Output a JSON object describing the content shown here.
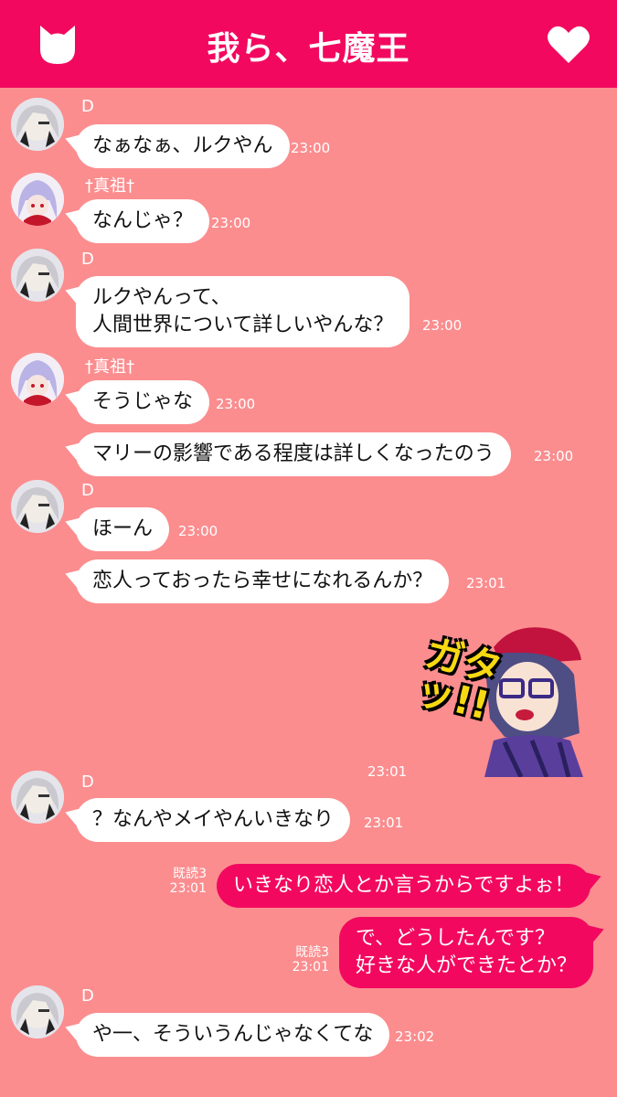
{
  "header": {
    "title": "我ら、七魔王",
    "left_icon": "cat-head-icon",
    "right_icon": "heart-icon",
    "color": "#f2095f"
  },
  "colors": {
    "background": "#fb8d8f",
    "bubble_in": "#ffffff",
    "bubble_out": "#f2095f"
  },
  "messages": [
    {
      "sender": "D",
      "text": "なぁなぁ、ルクやん",
      "time": "23:00"
    },
    {
      "sender": "†真祖†",
      "text": "なんじゃ？",
      "time": "23:00"
    },
    {
      "sender": "D",
      "text_lines": [
        "ルクやんって、",
        "人間世界について詳しいやんな？"
      ],
      "time": "23:00"
    },
    {
      "sender": "†真祖†",
      "text": "そうじゃな",
      "time": "23:00"
    },
    {
      "text": "マリーの影響である程度は詳しくなったのう",
      "time": "23:00"
    },
    {
      "sender": "D",
      "text": "ほーん",
      "time": "23:00"
    },
    {
      "text": "恋人っておったら幸せになれるんか？",
      "time": "23:01"
    },
    {
      "type": "sticker",
      "sticker_text": "ガタッ!!",
      "time": "23:01"
    },
    {
      "sender": "D",
      "text": "？なんやメイやんいきなり",
      "time": "23:01"
    },
    {
      "outgoing": true,
      "read": "既読3",
      "text": "いきなり恋人とか言うからですよぉ！",
      "time": "23:01"
    },
    {
      "outgoing": true,
      "read": "既読3",
      "text_lines": [
        "で、どうしたんです？",
        "好きな人ができたとか？"
      ],
      "time": "23:01"
    },
    {
      "sender": "D",
      "text": "や一、そういうんじゃなくてな",
      "time": "23:02"
    }
  ]
}
